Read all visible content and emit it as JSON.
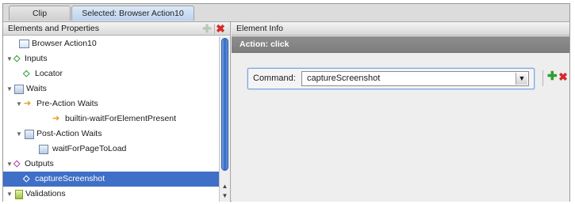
{
  "tabs": [
    {
      "label": "Clip"
    },
    {
      "label": "Selected: Browser Action10"
    }
  ],
  "left_panel": {
    "header": "Elements and Properties",
    "add_icon": "plus-icon",
    "delete_icon": "close-icon",
    "tree": [
      {
        "label": "Browser Action10",
        "icon": "browser-action-icon"
      },
      {
        "label": "Inputs",
        "icon": "green-diamond-icon",
        "twisty": "▼"
      },
      {
        "label": "Locator",
        "icon": "green-diamond-icon"
      },
      {
        "label": "Waits",
        "icon": "waits-icon",
        "twisty": "▼"
      },
      {
        "label": "Pre-Action Waits",
        "icon": "arrow-icon",
        "twisty": "▼"
      },
      {
        "label": "builtin-waitForElementPresent",
        "icon": "arrow-icon"
      },
      {
        "label": "Post-Action Waits",
        "icon": "waits-icon",
        "twisty": "▼"
      },
      {
        "label": "waitForPageToLoad",
        "icon": "waits-icon"
      },
      {
        "label": "Outputs",
        "icon": "purple-diamond-icon",
        "twisty": "▼"
      },
      {
        "label": "captureScreenshot",
        "icon": "purple-diamond-icon",
        "selected": true
      },
      {
        "label": "Validations",
        "icon": "validation-icon",
        "twisty": "▼"
      }
    ]
  },
  "right_panel": {
    "header": "Element Info",
    "action": "Action: click",
    "command_label": "Command:",
    "command_value": "captureScreenshot"
  },
  "colors": {
    "selection": "#3f6fc6",
    "action_bar": "#858585",
    "add_green": "#2e9f2e",
    "delete_red": "#d42a2a"
  }
}
